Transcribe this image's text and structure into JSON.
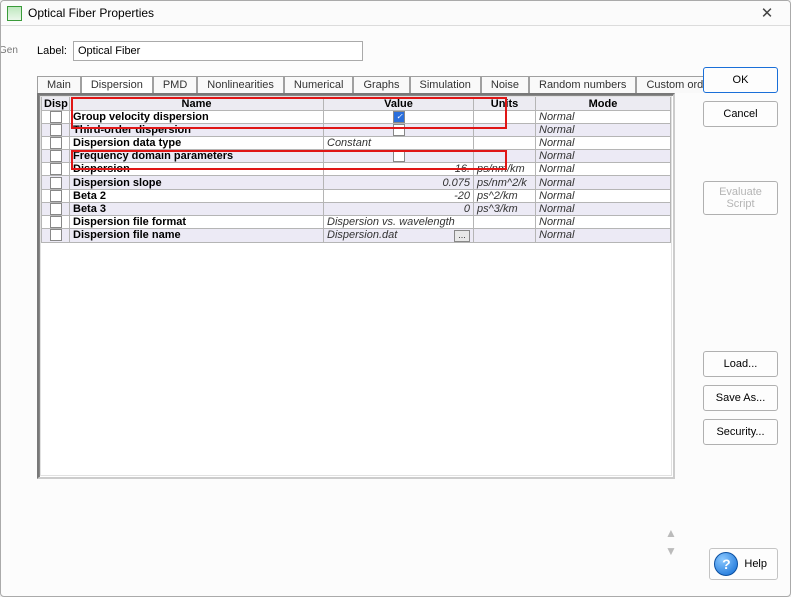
{
  "window": {
    "title": "Optical Fiber Properties"
  },
  "side_caption": "Gen",
  "label_row": {
    "caption": "Label:",
    "value": "Optical Fiber"
  },
  "tabs": [
    {
      "label": "Main",
      "active": false
    },
    {
      "label": "Dispersion",
      "active": true
    },
    {
      "label": "PMD",
      "active": false
    },
    {
      "label": "Nonlinearities",
      "active": false
    },
    {
      "label": "Numerical",
      "active": false
    },
    {
      "label": "Graphs",
      "active": false
    },
    {
      "label": "Simulation",
      "active": false
    },
    {
      "label": "Noise",
      "active": false
    },
    {
      "label": "Random numbers",
      "active": false
    },
    {
      "label": "Custom order",
      "active": false
    }
  ],
  "columns": {
    "disp": "Disp",
    "name": "Name",
    "value": "Value",
    "units": "Units",
    "mode": "Mode"
  },
  "rows": [
    {
      "name": "Group velocity dispersion",
      "value": "",
      "value_check": true,
      "units": "",
      "mode": "Normal"
    },
    {
      "name": "Third-order dispersion",
      "value": "",
      "value_check": false,
      "units": "",
      "mode": "Normal"
    },
    {
      "name": "Dispersion data type",
      "value": "Constant",
      "units": "",
      "mode": "Normal",
      "value_align": "left"
    },
    {
      "name": "Frequency domain parameters",
      "value": "",
      "value_check": false,
      "units": "",
      "mode": "Normal"
    },
    {
      "name": "Dispersion",
      "value": "16.",
      "units": "ps/nm/km",
      "mode": "Normal"
    },
    {
      "name": "Dispersion slope",
      "value": "0.075",
      "units": "ps/nm^2/k",
      "mode": "Normal"
    },
    {
      "name": "Beta 2",
      "value": "-20",
      "units": "ps^2/km",
      "mode": "Normal"
    },
    {
      "name": "Beta 3",
      "value": "0",
      "units": "ps^3/km",
      "mode": "Normal"
    },
    {
      "name": "Dispersion file format",
      "value": "Dispersion vs. wavelength",
      "units": "",
      "mode": "Normal",
      "value_align": "left"
    },
    {
      "name": "Dispersion file name",
      "value": "Dispersion.dat",
      "units": "",
      "mode": "Normal",
      "value_align": "left",
      "browse": true
    }
  ],
  "buttons": {
    "ok": "OK",
    "cancel": "Cancel",
    "evaluate": "Evaluate Script",
    "load": "Load...",
    "saveas": "Save As...",
    "security": "Security...",
    "help": "Help"
  }
}
